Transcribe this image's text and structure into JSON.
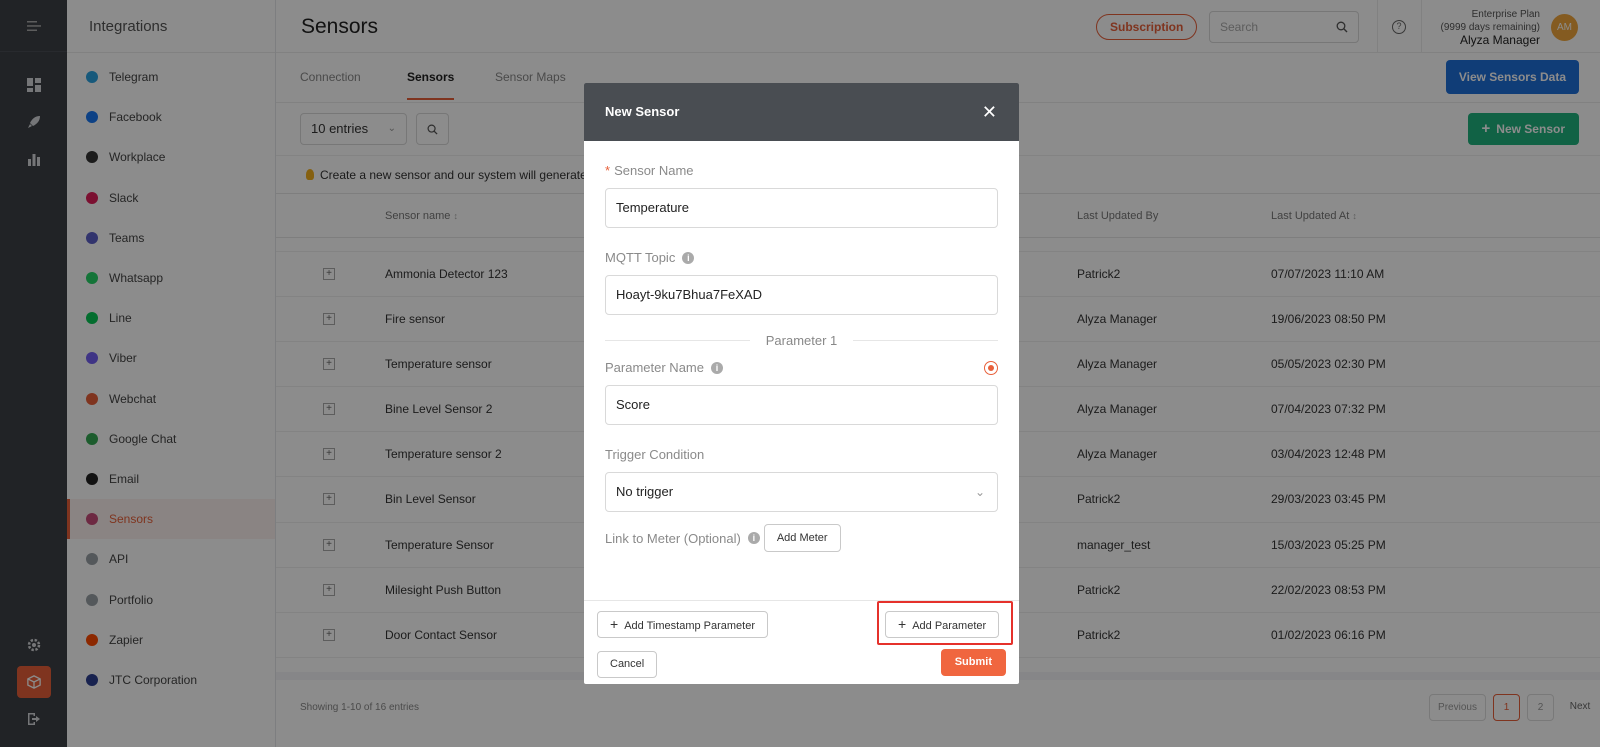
{
  "rail": {
    "icons": [
      "collapse-icon",
      "dashboard-icon",
      "rocket-icon",
      "chart-icon",
      "settings-icon",
      "cube-icon",
      "logout-icon"
    ]
  },
  "sidebar": {
    "title": "Integrations",
    "items": [
      {
        "label": "Telegram",
        "color": "#2aa3e0"
      },
      {
        "label": "Facebook",
        "color": "#1877f2"
      },
      {
        "label": "Workplace",
        "color": "#333333"
      },
      {
        "label": "Slack",
        "color": "#e01e5a"
      },
      {
        "label": "Teams",
        "color": "#5b5fc7"
      },
      {
        "label": "Whatsapp",
        "color": "#25d366"
      },
      {
        "label": "Line",
        "color": "#06c755"
      },
      {
        "label": "Viber",
        "color": "#7360f2"
      },
      {
        "label": "Webchat",
        "color": "#e8603a"
      },
      {
        "label": "Google Chat",
        "color": "#34a853"
      },
      {
        "label": "Email",
        "color": "#222222"
      },
      {
        "label": "Sensors",
        "color": "#c74b78"
      },
      {
        "label": "API",
        "color": "#9aa0a6"
      },
      {
        "label": "Portfolio",
        "color": "#9aa0a6"
      },
      {
        "label": "Zapier",
        "color": "#ff4a00"
      },
      {
        "label": "JTC Corporation",
        "color": "#2c3e91"
      }
    ],
    "active_index": 11
  },
  "header": {
    "title": "Sensors",
    "subscription": "Subscription",
    "search_placeholder": "Search",
    "plan": "Enterprise Plan",
    "days": "(9999 days remaining)",
    "user": "Alyza Manager",
    "avatar": "AM"
  },
  "tabs": {
    "items": [
      "Connection",
      "Sensors",
      "Sensor Maps"
    ],
    "view_data": "View Sensors Data"
  },
  "toolbar": {
    "entries": "10 entries",
    "new_sensor": "New Sensor",
    "info": "Create a new sensor and our system will generate a"
  },
  "table": {
    "headers": [
      "Sensor name",
      "Last Updated By",
      "Last Updated At"
    ],
    "rows": [
      {
        "name": "Ammonia Detector 123",
        "by": "Patrick2",
        "at": "07/07/2023 11:10 AM"
      },
      {
        "name": "Fire sensor",
        "by": "Alyza Manager",
        "at": "19/06/2023 08:50 PM"
      },
      {
        "name": "Temperature sensor",
        "by": "Alyza Manager",
        "at": "05/05/2023 02:30 PM"
      },
      {
        "name": "Bine Level Sensor 2",
        "by": "Alyza Manager",
        "at": "07/04/2023 07:32 PM"
      },
      {
        "name": "Temperature sensor 2",
        "by": "Alyza Manager",
        "at": "03/04/2023 12:48 PM"
      },
      {
        "name": "Bin Level Sensor",
        "by": "Patrick2",
        "at": "29/03/2023 03:45 PM"
      },
      {
        "name": "Temperature Sensor",
        "by": "manager_test",
        "at": "15/03/2023 05:25 PM"
      },
      {
        "name": "Milesight Push Button",
        "by": "Patrick2",
        "at": "22/02/2023 08:53 PM"
      },
      {
        "name": "Door Contact Sensor",
        "by": "Patrick2",
        "at": "01/02/2023 06:16 PM"
      }
    ],
    "showing": "Showing 1-10 of 16 entries",
    "pagination": {
      "previous": "Previous",
      "pages": [
        "1",
        "2"
      ],
      "next": "Next"
    }
  },
  "modal": {
    "title": "New Sensor",
    "sensor_name_label": "Sensor Name",
    "sensor_name_value": "Temperature",
    "mqtt_label": "MQTT Topic",
    "mqtt_value": "Hoayt-9ku7Bhua7FeXAD",
    "parameter_heading": "Parameter 1",
    "param_name_label": "Parameter Name",
    "param_name_value": "Score",
    "trigger_label": "Trigger Condition",
    "trigger_value": "No trigger",
    "meter_label": "Link to Meter (Optional)",
    "add_meter": "Add Meter",
    "add_timestamp": "Add Timestamp Parameter",
    "add_parameter": "Add Parameter",
    "cancel": "Cancel",
    "submit": "Submit"
  }
}
